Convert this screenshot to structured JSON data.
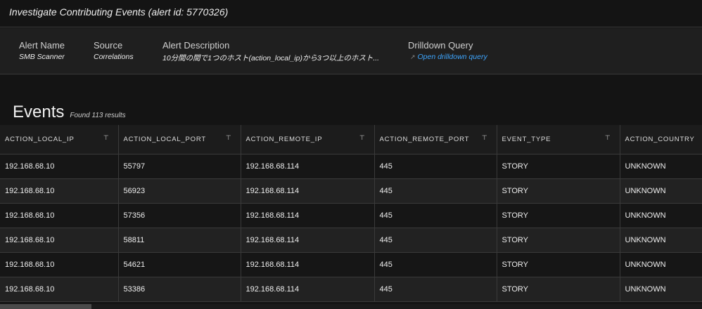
{
  "title": "Investigate Contributing Events (alert id: 5770326)",
  "info": {
    "alert_name_label": "Alert Name",
    "alert_name": "SMB Scanner",
    "source_label": "Source",
    "source": "Correlations",
    "desc_label": "Alert Description",
    "desc": "10分間の間で1つのホスト(action_local_ip)から3つ以上のホスト...",
    "drill_label": "Drilldown Query",
    "drill_link": "Open drilldown query",
    "drill_icon": "external-link-icon"
  },
  "events": {
    "heading": "Events",
    "count": "Found 113 results"
  },
  "columns": [
    "ACTION_LOCAL_IP",
    "ACTION_LOCAL_PORT",
    "ACTION_REMOTE_IP",
    "ACTION_REMOTE_PORT",
    "EVENT_TYPE",
    "ACTION_COUNTRY"
  ],
  "rows": [
    [
      "192.168.68.10",
      "55797",
      "192.168.68.114",
      "445",
      "STORY",
      "UNKNOWN"
    ],
    [
      "192.168.68.10",
      "56923",
      "192.168.68.114",
      "445",
      "STORY",
      "UNKNOWN"
    ],
    [
      "192.168.68.10",
      "57356",
      "192.168.68.114",
      "445",
      "STORY",
      "UNKNOWN"
    ],
    [
      "192.168.68.10",
      "58811",
      "192.168.68.114",
      "445",
      "STORY",
      "UNKNOWN"
    ],
    [
      "192.168.68.10",
      "54621",
      "192.168.68.114",
      "445",
      "STORY",
      "UNKNOWN"
    ],
    [
      "192.168.68.10",
      "53386",
      "192.168.68.114",
      "445",
      "STORY",
      "UNKNOWN"
    ]
  ],
  "colors": {
    "link": "#3ea6ff",
    "background": "#141414"
  }
}
